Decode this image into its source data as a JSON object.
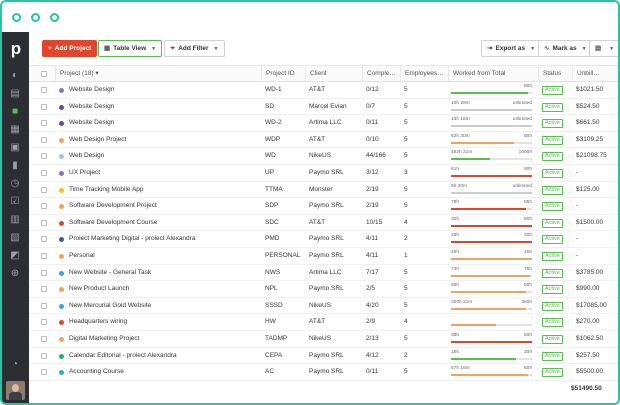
{
  "toolbar": {
    "add_project": "Add Project",
    "table_view": "Table View",
    "add_filter": "Add Filter",
    "export_as": "Export as",
    "mark_as": "Mark as"
  },
  "columns": [
    "Project (18)",
    "Project ID",
    "Client",
    "Comple…",
    "Employees…",
    "Worked from Total",
    "Status",
    "Unbill…"
  ],
  "rows": [
    {
      "name": "Website Design",
      "id": "WD-1",
      "client": "AT&T",
      "completed": "0/12",
      "employees": "5",
      "worked": "",
      "total": "80h",
      "progress": 0.95,
      "bar_color": "#54c24a",
      "status": "Active",
      "unbilled": "$1021.50",
      "dot": "#8a6fc9"
    },
    {
      "name": "Website Design",
      "id": "SD",
      "client": "Marcel Evian",
      "completed": "0/7",
      "employees": "5",
      "worked": "10h 29m",
      "total": "unlimited",
      "progress": 1.0,
      "bar_color": "#c9cdd1",
      "status": "Active",
      "unbilled": "$524.50",
      "dot": "#6a4aa8"
    },
    {
      "name": "Website Design",
      "id": "WD-2",
      "client": "Artima LLC",
      "completed": "0/11",
      "employees": "5",
      "worked": "13h 18m",
      "total": "unlimited",
      "progress": 1.0,
      "bar_color": "#c9cdd1",
      "status": "Active",
      "unbilled": "$661.50",
      "dot": "#6a4aa8"
    },
    {
      "name": "Web Design Project",
      "id": "WDP",
      "client": "AT&T",
      "completed": "0/10",
      "employees": "5",
      "worked": "62h 30m",
      "total": "80h",
      "progress": 0.78,
      "bar_color": "#f0a35e",
      "status": "Active",
      "unbilled": "$3109.25",
      "dot": "#f0a35e"
    },
    {
      "name": "Web Design",
      "id": "WD",
      "client": "NikeUS",
      "completed": "44/166",
      "employees": "5",
      "worked": "482h 21m",
      "total": "1000h",
      "progress": 0.48,
      "bar_color": "#54c24a",
      "status": "Active",
      "unbilled": "$21098.75",
      "dot": "#9fc3e6"
    },
    {
      "name": "UX Project",
      "id": "UP",
      "client": "Paymo SRL",
      "completed": "3/12",
      "employees": "3",
      "worked": "61h",
      "total": "50h",
      "progress": 1.0,
      "bar_color": "#e1462c",
      "status": "Active",
      "unbilled": "-",
      "dot": "#8a6fc9"
    },
    {
      "name": "Time Tracking Mobile App",
      "id": "TTMA",
      "client": "Monster",
      "completed": "2/19",
      "employees": "5",
      "worked": "6h 30m",
      "total": "unlimited",
      "progress": 1.0,
      "bar_color": "#c9cdd1",
      "status": "Active",
      "unbilled": "$125.00",
      "dot": "#f1c40f"
    },
    {
      "name": "Software Development Project",
      "id": "SDP",
      "client": "Paymo SRL",
      "completed": "2/19",
      "employees": "5",
      "worked": "78h",
      "total": "85h",
      "progress": 0.92,
      "bar_color": "#e1462c",
      "status": "Active",
      "unbilled": "-",
      "dot": "#f0a35e"
    },
    {
      "name": "Software Development Course",
      "id": "SDC",
      "client": "AT&T",
      "completed": "10/15",
      "employees": "4",
      "worked": "30h",
      "total": "80h",
      "progress": 1.0,
      "bar_color": "#e1462c",
      "status": "Active",
      "unbilled": "$1500.00",
      "dot": "#e1462c"
    },
    {
      "name": "Proiect Marketing Digital - proiect Alexandra",
      "id": "PMD",
      "client": "Paymo SRL",
      "completed": "4/11",
      "employees": "2",
      "worked": "25h",
      "total": "20h",
      "progress": 1.0,
      "bar_color": "#e1462c",
      "status": "Active",
      "unbilled": "-",
      "dot": "#3b5ca8"
    },
    {
      "name": "Personal",
      "id": "PERSONAL",
      "client": "Paymo SRL",
      "completed": "4/11",
      "employees": "1",
      "worked": "45h",
      "total": "45h",
      "progress": 1.0,
      "bar_color": "#f0a35e",
      "status": "Active",
      "unbilled": "-",
      "dot": "#f0a35e"
    },
    {
      "name": "New Website - General Task",
      "id": "NWS",
      "client": "Artima LLC",
      "completed": "7/17",
      "employees": "5",
      "worked": "73h",
      "total": "75h",
      "progress": 0.97,
      "bar_color": "#f0a35e",
      "status": "Active",
      "unbilled": "$3785.00",
      "dot": "#2fa8e0"
    },
    {
      "name": "New Product Launch",
      "id": "NPL",
      "client": "Paymo SRL",
      "completed": "2/5",
      "employees": "5",
      "worked": "55h",
      "total": "60h",
      "progress": 0.92,
      "bar_color": "#f0a35e",
      "status": "Active",
      "unbilled": "$990.00",
      "dot": "#f0a35e"
    },
    {
      "name": "New Mercurial Gold Website",
      "id": "SSSD",
      "client": "NikeUS",
      "completed": "4/20",
      "employees": "5",
      "worked": "320h 21m",
      "total": "350h",
      "progress": 0.92,
      "bar_color": "#f0a35e",
      "status": "Active",
      "unbilled": "$17085.00",
      "dot": "#2fa8e0"
    },
    {
      "name": "Headquarters wiring",
      "id": "HW",
      "client": "AT&T",
      "completed": "2/9",
      "employees": "4",
      "worked": "",
      "total": "",
      "progress": 0.55,
      "bar_color": "#f0a35e",
      "status": "Active",
      "unbilled": "$270.00",
      "dot": "#e1462c"
    },
    {
      "name": "Digital Marketing Project",
      "id": "TADMP",
      "client": "NikeUS",
      "completed": "2/13",
      "employees": "5",
      "worked": "38h",
      "total": "50h",
      "progress": 1.0,
      "bar_color": "#e1462c",
      "status": "Active",
      "unbilled": "$1062.50",
      "dot": "#f0a35e"
    },
    {
      "name": "Calendar Editorial - proiect Alexandra",
      "id": "CEPA",
      "client": "Paymo SRL",
      "completed": "4/12",
      "employees": "2",
      "worked": "16h",
      "total": "20h",
      "progress": 0.8,
      "bar_color": "#54c24a",
      "status": "Active",
      "unbilled": "$257.50",
      "dot": "#27ae60"
    },
    {
      "name": "Accounting Course",
      "id": "AC",
      "client": "Paymo SRL",
      "completed": "0/11",
      "employees": "5",
      "worked": "57h 15m",
      "total": "60h",
      "progress": 0.95,
      "bar_color": "#f0a35e",
      "status": "Active",
      "unbilled": "$5500.00",
      "dot": "#2fa8e0"
    }
  ],
  "total_unbilled": "$51490.50"
}
